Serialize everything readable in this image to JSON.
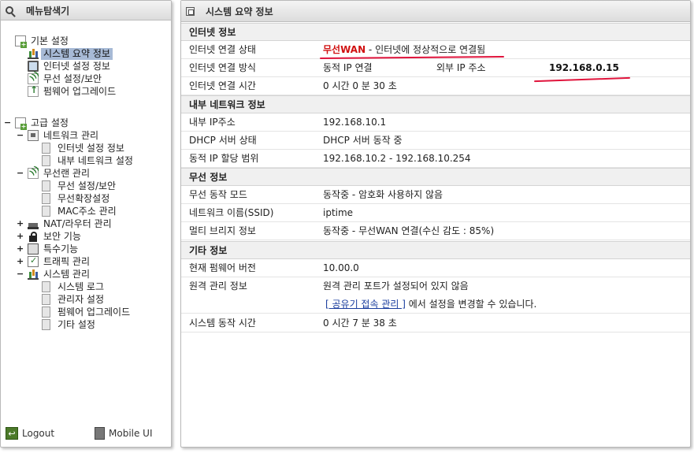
{
  "nav": {
    "title": "메뉴탐색기",
    "basic": {
      "label": "기본 설정",
      "items": [
        {
          "label": "시스템 요약 정보",
          "icon": "chart-icon"
        },
        {
          "label": "인터넷 설정 정보",
          "icon": "monitor-icon"
        },
        {
          "label": "무선 설정/보안",
          "icon": "wireless-icon"
        },
        {
          "label": "펌웨어 업그레이드",
          "icon": "upload-icon"
        }
      ]
    },
    "advanced": {
      "label": "고급 설정",
      "network": {
        "label": "네트워크 관리",
        "items": [
          "인터넷 설정 정보",
          "내부 네트워크 설정"
        ]
      },
      "wireless": {
        "label": "무선랜 관리",
        "items": [
          "무선 설정/보안",
          "무선확장설정",
          "MAC주소 관리"
        ]
      },
      "nat": "NAT/라우터 관리",
      "security": "보안 기능",
      "special": "특수기능",
      "traffic": "트래픽 관리",
      "system": {
        "label": "시스템 관리",
        "items": [
          "시스템 로그",
          "관리자 설정",
          "펌웨어 업그레이드",
          "기타 설정"
        ]
      }
    },
    "footer": {
      "logout": "Logout",
      "mobile": "Mobile UI"
    }
  },
  "main": {
    "title": "시스템 요약 정보",
    "internet": {
      "heading": "인터넷 정보",
      "status_label": "인터넷 연결 상태",
      "status_highlight": "무선WAN",
      "status_text": " - 인터넷에 정상적으로 연결됨",
      "method_label": "인터넷 연결 방식",
      "method_value": "동적 IP 연결",
      "external_ip_label": "외부 IP 주소",
      "external_ip_value": "192.168.0.15",
      "time_label": "인터넷 연결 시간",
      "time_value": "0 시간 0 분 30 초"
    },
    "lan": {
      "heading": "내부 네트워크 정보",
      "ip_label": "내부 IP주소",
      "ip_value": "192.168.10.1",
      "dhcp_label": "DHCP 서버 상태",
      "dhcp_value": "DHCP 서버 동작 중",
      "range_label": "동적 IP 할당 범위",
      "range_value": "192.168.10.2 -  192.168.10.254"
    },
    "wireless": {
      "heading": "무선 정보",
      "mode_label": "무선 동작 모드",
      "mode_value": "동작중 - 암호화 사용하지 않음",
      "ssid_label": "네트워크 이름(SSID)",
      "ssid_value": "iptime",
      "bridge_label": "멀티 브리지 정보",
      "bridge_value": "동작중 - 무선WAN 연결(수신 감도 : 85%)"
    },
    "etc": {
      "heading": "기타 정보",
      "fw_label": "현재 펌웨어 버전",
      "fw_value": "10.00.0",
      "remote_label": "원격 관리 정보",
      "remote_value": "원격 관리 포트가 설정되어 있지 않음",
      "remote_link": "[ 공유기 접속 관리 ]",
      "remote_suffix": " 에서 설정을 변경할 수 있습니다.",
      "uptime_label": "시스템 동작 시간",
      "uptime_value": "0 시간 7 분 38 초"
    }
  },
  "colors": {
    "highlight_red": "#d01010",
    "annotation_red": "#e0143c",
    "selection": "#a7bad6",
    "link": "#1a3d9e"
  }
}
